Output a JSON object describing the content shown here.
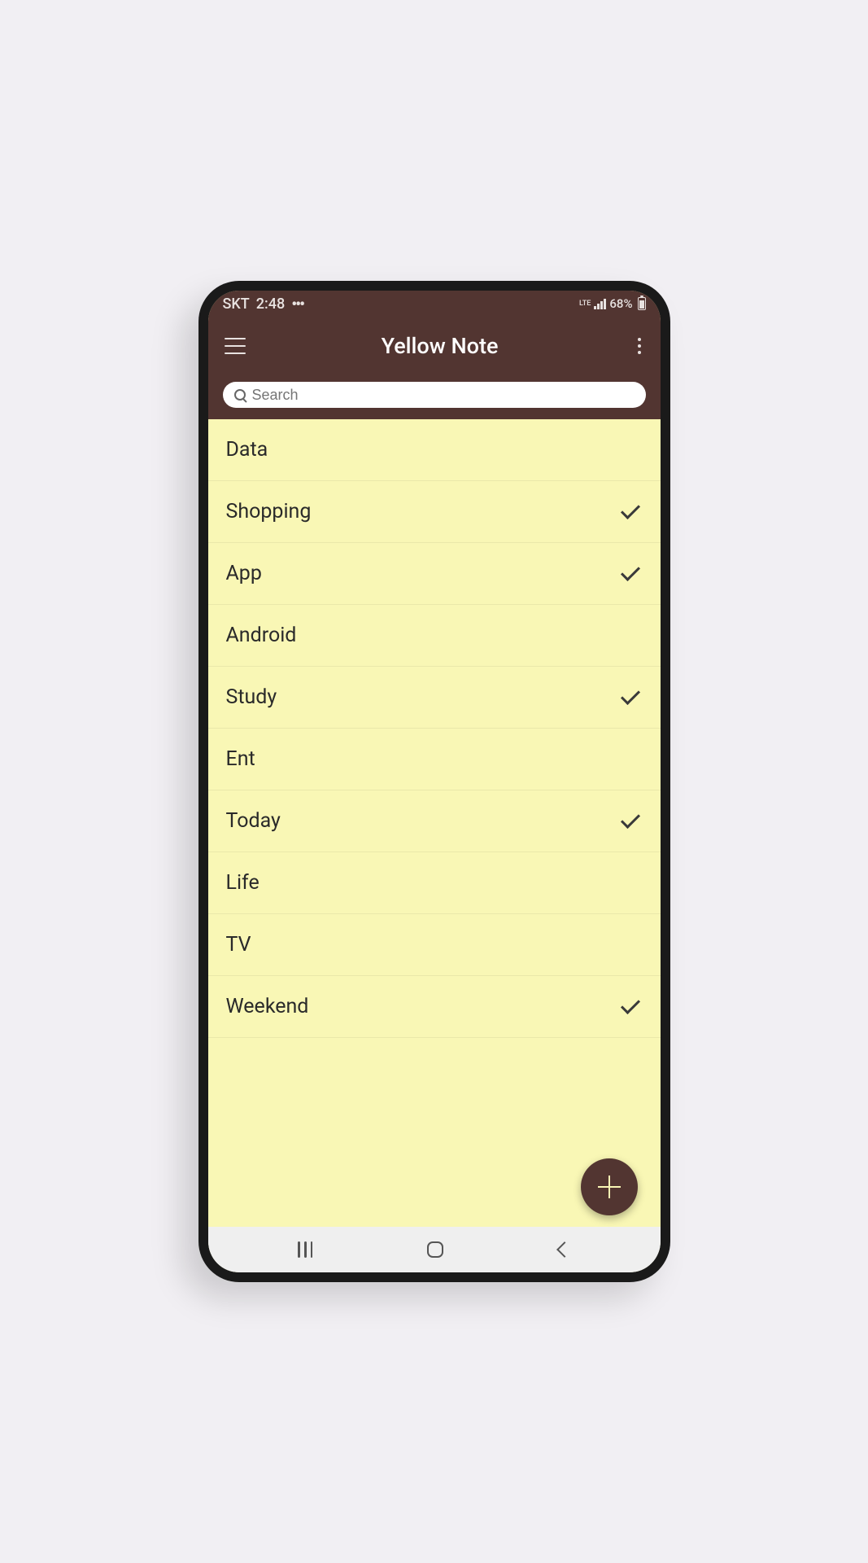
{
  "status": {
    "carrier": "SKT",
    "time": "2:48",
    "network": "LTE",
    "battery": "68%"
  },
  "header": {
    "title": "Yellow Note"
  },
  "search": {
    "placeholder": "Search"
  },
  "notes": [
    {
      "label": "Data",
      "checked": false
    },
    {
      "label": "Shopping",
      "checked": true
    },
    {
      "label": "App",
      "checked": true
    },
    {
      "label": "Android",
      "checked": false
    },
    {
      "label": "Study",
      "checked": true
    },
    {
      "label": "Ent",
      "checked": false
    },
    {
      "label": "Today",
      "checked": true
    },
    {
      "label": "Life",
      "checked": false
    },
    {
      "label": "TV",
      "checked": false
    },
    {
      "label": "Weekend",
      "checked": true
    }
  ],
  "colors": {
    "header_bg": "#523531",
    "note_bg": "#f9f7b5",
    "page_bg": "#f1eff3"
  }
}
